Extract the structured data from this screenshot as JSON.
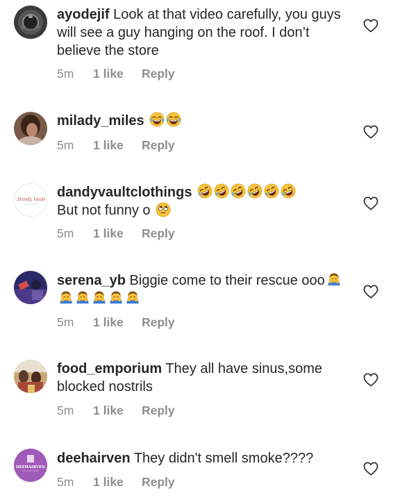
{
  "comments": [
    {
      "username": "ayodejif",
      "text": "Look at that video carefully, you guys will see a guy hanging on the roof. I don’t believe the store",
      "time": "5m",
      "likes": "1 like",
      "reply": "Reply"
    },
    {
      "username": "milady_miles",
      "text": "",
      "time": "5m",
      "likes": "1 like",
      "reply": "Reply"
    },
    {
      "username": "dandyvaultclothings",
      "text": "But not funny o",
      "time": "5m",
      "likes": "1 like",
      "reply": "Reply",
      "avatar_text": "Dandy Vault"
    },
    {
      "username": "serena_yb",
      "text": "Biggie come to their rescue ooo",
      "time": "5m",
      "likes": "1 like",
      "reply": "Reply"
    },
    {
      "username": "food_emporium",
      "text": "They all have sinus,some blocked nostrils",
      "time": "5m",
      "likes": "1 like",
      "reply": "Reply"
    },
    {
      "username": "deehairven",
      "text": "They didn't smell smoke????",
      "time": "5m",
      "likes": "1 like",
      "reply": "Reply",
      "avatar_text": "DEEHAIRVEN"
    }
  ],
  "colors": {
    "text": "#262626",
    "meta": "#8e8e8e",
    "heart": "#262626",
    "emoji_face": "#f7c23c"
  },
  "icons": {
    "like": "heart-outline-icon",
    "laugh": "face-with-tears-of-joy-icon",
    "rofl": "rolling-on-floor-laughing-icon",
    "eyeroll": "face-with-rolling-eyes-icon",
    "bow": "person-bowing-icon"
  }
}
